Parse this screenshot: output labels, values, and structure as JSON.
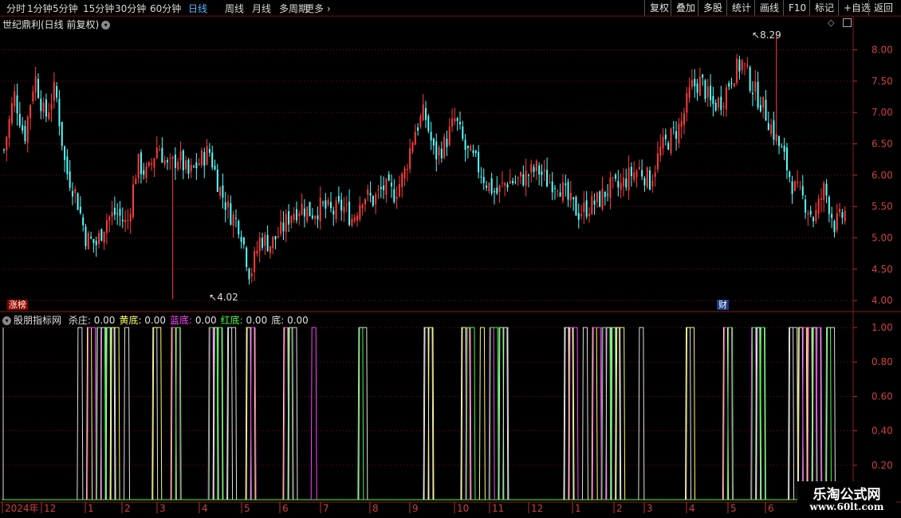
{
  "toolbar": {
    "periods": [
      "分时",
      "1分钟",
      "5分钟",
      "15分钟",
      "30分钟",
      "60分钟",
      "日线",
      "周线",
      "月线",
      "多周期",
      "更多"
    ],
    "active_period": "日线",
    "right_buttons": [
      "复权",
      "叠加",
      "多股",
      "统计",
      "画线",
      "F10",
      "标记",
      "+自选",
      "返回"
    ]
  },
  "main_chart": {
    "title": "世纪鼎利(日线 前复权)",
    "y_ticks": [
      "8.00",
      "7.50",
      "7.00",
      "6.50",
      "6.00",
      "5.50",
      "5.00",
      "4.50",
      "4.00"
    ],
    "high_label": "8.29",
    "low_label": "4.02",
    "badge_left": "涨榜",
    "badge_cai": "财"
  },
  "indicator": {
    "name": "股朋指标网",
    "items": [
      {
        "label": "杀庄:",
        "value": "0.00",
        "color": "#e0e0e0"
      },
      {
        "label": "黄底:",
        "value": "0.00",
        "color": "#ffff66"
      },
      {
        "label": "蓝底:",
        "value": "0.00",
        "color": "#ff44ff"
      },
      {
        "label": "红底:",
        "value": "0.00",
        "color": "#44ff44"
      },
      {
        "label": "底:",
        "value": "0.00",
        "color": "#e0e0e0"
      }
    ],
    "y_ticks": [
      "1.00",
      "0.80",
      "0.60",
      "0.40",
      "0.20"
    ]
  },
  "x_axis": {
    "labels": [
      "2024年",
      "12",
      "1",
      "2",
      "3",
      "4",
      "5",
      "6",
      "7",
      "8",
      "9",
      "10",
      "11",
      "12",
      "1",
      "2",
      "3",
      "4",
      "5",
      "6"
    ]
  },
  "watermark": {
    "line1": "乐淘公式网",
    "line2": "www.60lt.com"
  },
  "chart_data": {
    "type": "candlestick",
    "title": "世纪鼎利(日线 前复权)",
    "ylim": [
      3.9,
      8.35
    ],
    "high": 8.29,
    "low": 4.02,
    "up_color": "#ff3c3c",
    "down_color": "#54ffff",
    "close_path": [
      6.4,
      7.3,
      6.6,
      7.6,
      6.9,
      7.4,
      6.1,
      5.7,
      5.0,
      4.9,
      5.3,
      5.4,
      5.2,
      6.2,
      6.0,
      6.5,
      6.1,
      6.3,
      6.0,
      6.2,
      6.4,
      5.8,
      5.4,
      5.2,
      4.4,
      5.0,
      4.9,
      5.1,
      5.4,
      5.5,
      5.4,
      5.5,
      5.4,
      5.5,
      5.3,
      5.7,
      5.6,
      5.8,
      5.7,
      6.0,
      6.7,
      7.0,
      6.3,
      6.5,
      6.9,
      6.4,
      6.2,
      5.9,
      5.7,
      5.9,
      5.9,
      6.0,
      6.1,
      5.9,
      5.9,
      5.6,
      5.4,
      5.5,
      5.6,
      5.8,
      5.8,
      6.0,
      6.1,
      5.9,
      6.4,
      6.6,
      6.8,
      7.4,
      7.5,
      7.1,
      7.2,
      7.6,
      7.8,
      7.4,
      7.1,
      6.7,
      6.3,
      5.8,
      5.6,
      5.3,
      5.8,
      5.2,
      5.4
    ],
    "indicator": {
      "series": [
        {
          "name": "杀庄",
          "color": "#e0e0e0"
        },
        {
          "name": "黄底",
          "color": "#ffff66"
        },
        {
          "name": "蓝底",
          "color": "#ff44ff"
        },
        {
          "name": "红底",
          "color": "#44ff44"
        },
        {
          "name": "底",
          "color": "#e0e0e0"
        }
      ],
      "ylim": [
        0,
        1.0
      ],
      "signal_columns": [
        8,
        9,
        10,
        11,
        13,
        16,
        18,
        22,
        23,
        24,
        26,
        30,
        33,
        38,
        45,
        49,
        51,
        52,
        53,
        60,
        62,
        63,
        64,
        65,
        68,
        73,
        77,
        80,
        81,
        84,
        85,
        86,
        87,
        88
      ]
    }
  }
}
